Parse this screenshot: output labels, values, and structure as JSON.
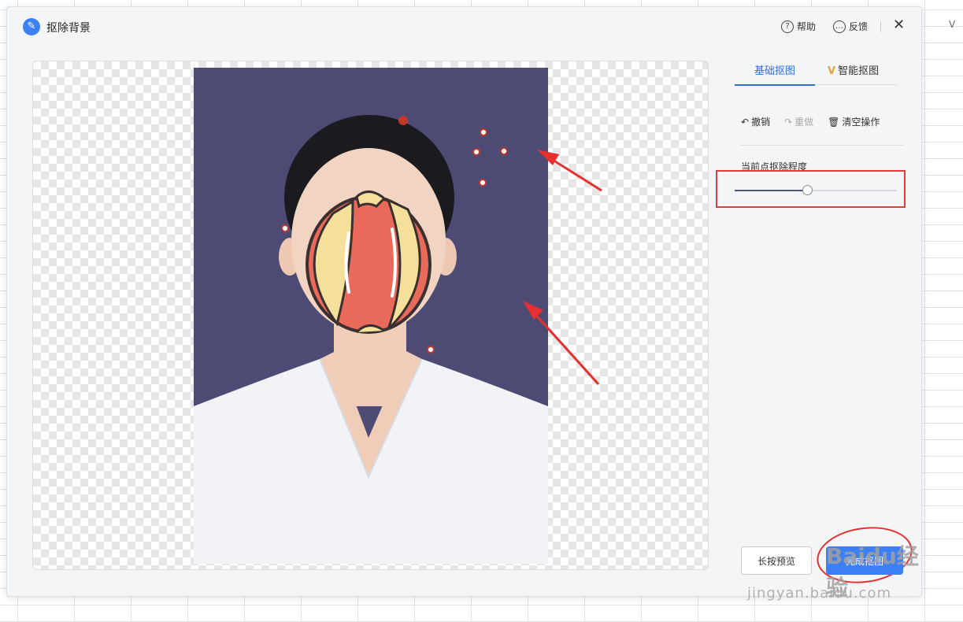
{
  "background": {
    "column_letter": "V"
  },
  "dialog": {
    "title": "抠除背景",
    "title_icon": "brush-magic-icon",
    "header": {
      "help_label": "帮助",
      "feedback_label": "反馈",
      "close_icon": "close-icon"
    }
  },
  "panel": {
    "tabs": [
      {
        "label": "基础抠图",
        "active": true
      },
      {
        "label": "智能抠图",
        "badge": "V",
        "active": false
      }
    ],
    "tools": {
      "undo_label": "撤销",
      "redo_label": "重做",
      "clear_label": "清空操作"
    },
    "degree": {
      "label": "当前点抠除程度",
      "value": 0.45
    }
  },
  "footer": {
    "preview_label": "长按预览",
    "done_label": "完成抠图"
  },
  "watermark": {
    "brand": "Bai du 经验",
    "url": "jingyan.baidu.com"
  },
  "colors": {
    "accent": "#3d7ff4",
    "highlight": "#e63b3b",
    "photo_bg": "#4d4a74"
  }
}
